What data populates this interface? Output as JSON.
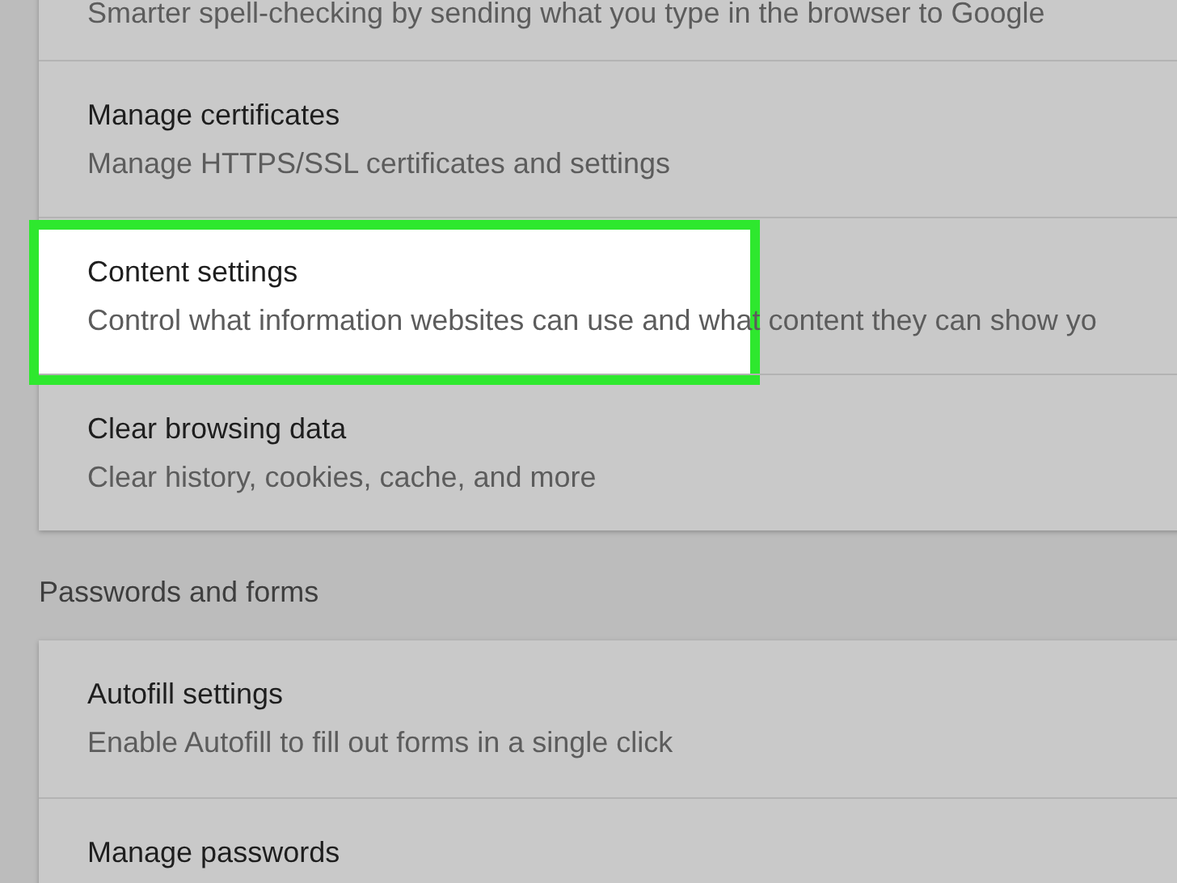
{
  "settings_groups": [
    {
      "rows": [
        {
          "description": "Smarter spell-checking by sending what you type in the browser to Google",
          "highlighted": false
        },
        {
          "title": "Manage certificates",
          "description": "Manage HTTPS/SSL certificates and settings",
          "highlighted": false
        },
        {
          "title": "Content settings",
          "description": "Control what information websites can use and what content they can show yo",
          "highlighted": true
        },
        {
          "title": "Clear browsing data",
          "description": "Clear history, cookies, cache, and more",
          "highlighted": false
        }
      ]
    },
    {
      "heading": "Passwords and forms",
      "rows": [
        {
          "title": "Autofill settings",
          "description": "Enable Autofill to fill out forms in a single click",
          "highlighted": false
        },
        {
          "title": "Manage passwords",
          "highlighted": false
        }
      ]
    }
  ]
}
